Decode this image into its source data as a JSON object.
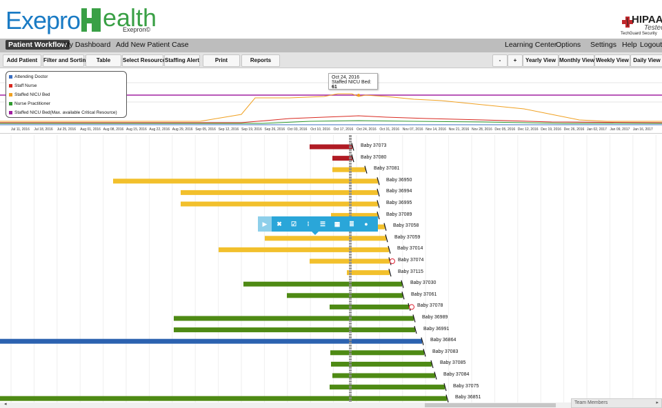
{
  "brand": {
    "name_a": "Exepron",
    "name_b": "ealth",
    "sub": "Exepron©"
  },
  "badge": {
    "title": "HIPAA",
    "subtitle": "Tested",
    "org": "TechGuard Security"
  },
  "nav": {
    "left": [
      "Patient Workflow",
      "My Dashboard",
      "Add New Patient Case"
    ],
    "right": [
      "Learning Center",
      "Options",
      "Settings",
      "Help",
      "Logout"
    ]
  },
  "toolbar": {
    "left": [
      "Add Patient",
      "Filter and Sorting",
      "Table",
      "Select Resources",
      "Staffing Alert",
      "Print",
      "Reports"
    ],
    "zoom_out": "-",
    "zoom_in": "+",
    "views": [
      "Yearly View",
      "Monthly View",
      "Weekly View",
      "Daily View"
    ]
  },
  "legend": [
    {
      "label": "Attending Doctor",
      "color": "#3b6fc1"
    },
    {
      "label": "Staff Nurse",
      "color": "#d9281f"
    },
    {
      "label": "Staffed NICU Bed",
      "color": "#f0a020"
    },
    {
      "label": "Nurse Practitioner",
      "color": "#2e9a2e"
    },
    {
      "label": "Staffed NICU Bed(Max. available Critical Resource)",
      "color": "#a020a0"
    }
  ],
  "tooltip": {
    "date": "Oct 24, 2016",
    "label": "Staffed NICU Bed:",
    "value": "61"
  },
  "axis_dates": [
    "Jul 11, 2016",
    "Jul 18, 2016",
    "Jul 25, 2016",
    "Aug 01, 2016",
    "Aug 08, 2016",
    "Aug 15, 2016",
    "Aug 22, 2016",
    "Aug 29, 2016",
    "Sep 05, 2016",
    "Sep 12, 2016",
    "Sep 19, 2016",
    "Sep 26, 2016",
    "Oct 03, 2016",
    "Oct 10, 2016",
    "Oct 17, 2016",
    "Oct 24, 2016",
    "Oct 31, 2016",
    "Nov 07, 2016",
    "Nov 14, 2016",
    "Nov 21, 2016",
    "Nov 28, 2016",
    "Dec 05, 2016",
    "Dec 12, 2016",
    "Dec 19, 2016",
    "Dec 26, 2016",
    "Jan 02, 2017",
    "Jan 09, 2017",
    "Jan 16, 2017"
  ],
  "colors": {
    "red": "#b01b24",
    "yellow": "#f2c02c",
    "green": "#4e8a14",
    "blue": "#2c62b0",
    "today": "#8a8a8a"
  },
  "tasks": [
    {
      "label": "Baby 37073",
      "kind": "red"
    },
    {
      "label": "Baby 37080",
      "kind": "red"
    },
    {
      "label": "Baby 37081",
      "kind": "yellow"
    },
    {
      "label": "Baby 36950",
      "kind": "yellow"
    },
    {
      "label": "Baby 36994",
      "kind": "yellow"
    },
    {
      "label": "Baby 36995",
      "kind": "yellow"
    },
    {
      "label": "Baby 37089",
      "kind": "yellow"
    },
    {
      "label": "Baby 37058",
      "kind": "yellow"
    },
    {
      "label": "Baby 37059",
      "kind": "yellow"
    },
    {
      "label": "Baby 37014",
      "kind": "yellow"
    },
    {
      "label": "Baby 37074",
      "kind": "yellow"
    },
    {
      "label": "Baby 37115",
      "kind": "yellow"
    },
    {
      "label": "Baby 37030",
      "kind": "green"
    },
    {
      "label": "Baby 37061",
      "kind": "green"
    },
    {
      "label": "Baby 37078",
      "kind": "green"
    },
    {
      "label": "Baby 36989",
      "kind": "green"
    },
    {
      "label": "Baby 36991",
      "kind": "green"
    },
    {
      "label": "Baby 36864",
      "kind": "blue"
    },
    {
      "label": "Baby 37083",
      "kind": "green"
    },
    {
      "label": "Baby 37085",
      "kind": "green"
    },
    {
      "label": "Baby 37084",
      "kind": "green"
    },
    {
      "label": "Baby 37075",
      "kind": "green"
    },
    {
      "label": "Baby 36851",
      "kind": "green"
    }
  ],
  "popup_icons": [
    "play-icon",
    "close-icon",
    "check-icon",
    "split-icon",
    "edit-icon",
    "calendar-icon",
    "list-icon",
    "user-icon"
  ],
  "team": {
    "label": "Team Members"
  }
}
